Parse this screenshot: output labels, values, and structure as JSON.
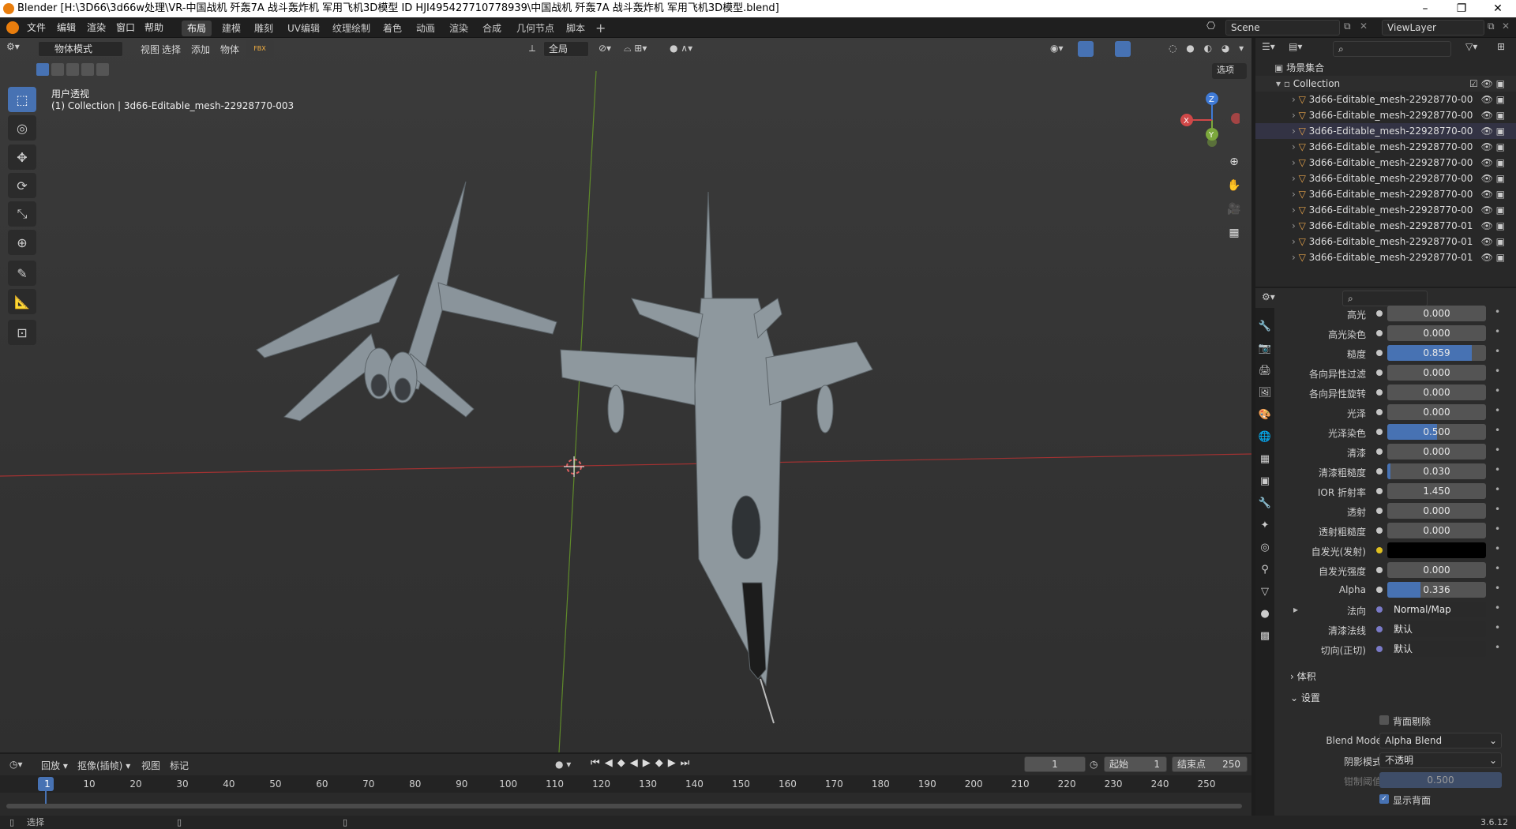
{
  "titlebar": {
    "title": "Blender [H:\\3D66\\3d66w处理\\VR-中国战机 歼轰7A 战斗轰炸机 军用飞机3D模型 ID HJI495427710778939\\中国战机 歼轰7A 战斗轰炸机 军用飞机3D模型.blend]"
  },
  "menu": [
    "文件",
    "编辑",
    "渲染",
    "窗口",
    "帮助"
  ],
  "workspaces": [
    "布局",
    "建模",
    "雕刻",
    "UV编辑",
    "纹理绘制",
    "着色",
    "动画",
    "渲染",
    "合成",
    "几何节点",
    "脚本"
  ],
  "scene": {
    "label": "Scene",
    "viewlayer": "ViewLayer"
  },
  "viewport": {
    "mode": "物体模式",
    "menus": [
      "视图",
      "选择",
      "添加",
      "物体"
    ],
    "transform": "全局",
    "options": "选项",
    "view_name": "用户透视",
    "collection_info": "(1) Collection | 3d66-Editable_mesh-22928770-003",
    "gizmo": {
      "z": "Z",
      "y": "Y",
      "x": "X"
    }
  },
  "outliner": {
    "root": "场景集合",
    "collection": "Collection",
    "items": [
      "3d66-Editable_mesh-22928770-00",
      "3d66-Editable_mesh-22928770-00",
      "3d66-Editable_mesh-22928770-00",
      "3d66-Editable_mesh-22928770-00",
      "3d66-Editable_mesh-22928770-00",
      "3d66-Editable_mesh-22928770-00",
      "3d66-Editable_mesh-22928770-00",
      "3d66-Editable_mesh-22928770-00",
      "3d66-Editable_mesh-22928770-01",
      "3d66-Editable_mesh-22928770-01",
      "3d66-Editable_mesh-22928770-01"
    ]
  },
  "properties": {
    "rows": [
      {
        "label": "高光",
        "value": "0.000",
        "fill": 0
      },
      {
        "label": "高光染色",
        "value": "0.000",
        "fill": 0
      },
      {
        "label": "糙度",
        "value": "0.859",
        "fill": 0.859
      },
      {
        "label": "各向异性过滤",
        "value": "0.000",
        "fill": 0
      },
      {
        "label": "各向异性旋转",
        "value": "0.000",
        "fill": 0
      },
      {
        "label": "光泽",
        "value": "0.000",
        "fill": 0
      },
      {
        "label": "光泽染色",
        "value": "0.500",
        "fill": 0.5
      },
      {
        "label": "清漆",
        "value": "0.000",
        "fill": 0
      },
      {
        "label": "清漆粗糙度",
        "value": "0.030",
        "fill": 0.03
      },
      {
        "label": "IOR 折射率",
        "value": "1.450",
        "fill": 0
      },
      {
        "label": "透射",
        "value": "0.000",
        "fill": 0
      },
      {
        "label": "透射粗糙度",
        "value": "0.000",
        "fill": 0
      },
      {
        "label": "自发光(发射)",
        "value": "",
        "fill": 0
      },
      {
        "label": "自发光强度",
        "value": "0.000",
        "fill": 0
      },
      {
        "label": "Alpha",
        "value": "0.336",
        "fill": 0.336
      },
      {
        "label": "法向",
        "value": "Normal/Map",
        "fill": 0
      },
      {
        "label": "清漆法线",
        "value": "默认",
        "fill": 0
      },
      {
        "label": "切向(正切)",
        "value": "默认",
        "fill": 0
      }
    ],
    "volume_panel": "体积",
    "settings_panel": "设置",
    "backface_culling": "背面剔除",
    "blend_mode_label": "Blend Mode",
    "blend_mode": "Alpha Blend",
    "shadow_mode_label": "阴影模式",
    "shadow_mode": "不透明",
    "clip_label": "钳制阈值",
    "clip_value": "0.500",
    "show_backface": "显示背面"
  },
  "timeline": {
    "menus": [
      "回放",
      "抠像(插帧)",
      "视图",
      "标记"
    ],
    "current_frame": "1",
    "start_label": "起始",
    "start": "1",
    "end_label": "结束点",
    "end": "250",
    "ticks": [
      "1",
      "10",
      "20",
      "30",
      "40",
      "50",
      "60",
      "70",
      "80",
      "90",
      "100",
      "110",
      "120",
      "130",
      "140",
      "150",
      "160",
      "170",
      "180",
      "190",
      "200",
      "210",
      "220",
      "230",
      "240",
      "250"
    ]
  },
  "status": {
    "select": "选择",
    "version": "3.6.12"
  },
  "colors": {
    "accent": "#4772b3",
    "x_axis": "#c43c3c",
    "y_axis": "#6d9c2c",
    "object_orange": "#e8a44a"
  }
}
